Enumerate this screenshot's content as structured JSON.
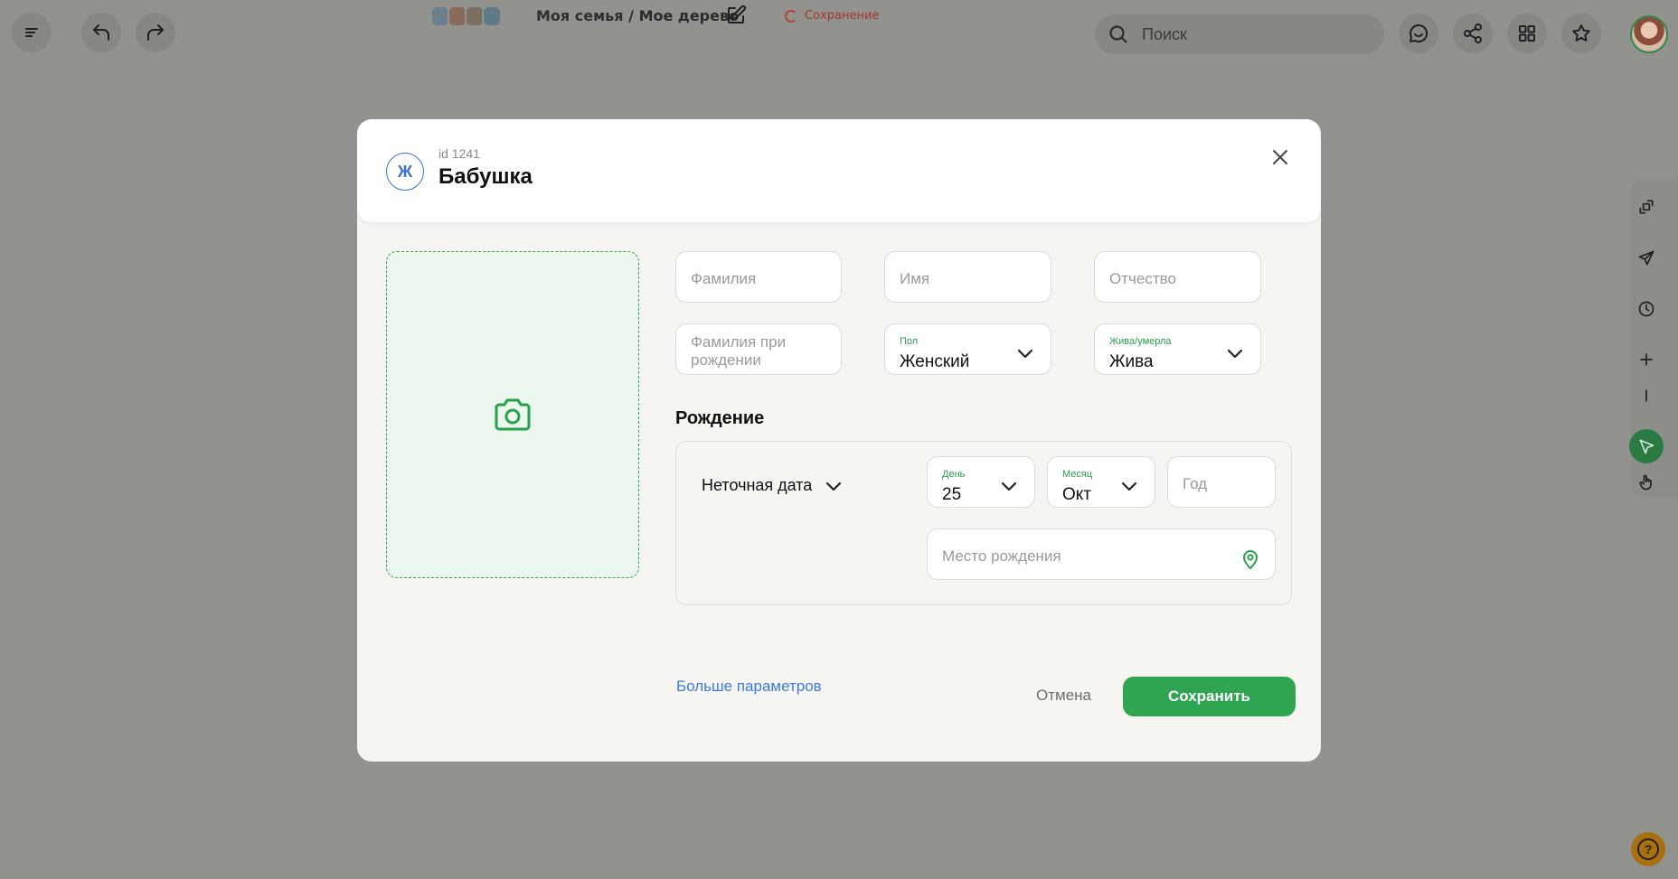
{
  "topbar": {
    "breadcrumb_family": "Моя семья",
    "breadcrumb_separator": "/",
    "breadcrumb_tree": "Мое дерево",
    "saving_status": "Сохранение",
    "search_placeholder": "Поиск"
  },
  "icons": {
    "menu": "menu-icon",
    "undo": "undo-icon",
    "redo": "redo-icon",
    "edit": "pencil-icon",
    "search": "search-icon",
    "chat": "chat-icon",
    "share": "share-icon",
    "grid": "grid-icon",
    "star": "star-icon"
  },
  "modal": {
    "gender_letter": "Ж",
    "person_id": "id 1241",
    "person_name": "Бабушка",
    "fields": {
      "last_name_placeholder": "Фамилия",
      "first_name_placeholder": "Имя",
      "patronymic_placeholder": "Отчество",
      "birth_last_name_placeholder": "Фамилия при рождении",
      "gender_label": "Пол",
      "gender_value": "Женский",
      "alive_label": "Жива/умерла",
      "alive_value": "Жива"
    },
    "birth": {
      "title": "Рождение",
      "date_type": "Неточная дата",
      "day_label": "День",
      "day_value": "25",
      "month_label": "Месяц",
      "month_value": "Окт",
      "year_placeholder": "Год",
      "place_placeholder": "Место рождения"
    },
    "more_params": "Больше параметров",
    "cancel": "Отмена",
    "save": "Сохранить"
  },
  "help": "?",
  "colors": {
    "accent_green": "#2fa552",
    "link_blue": "#3b7be0",
    "saving_red": "#a3362d",
    "overlay": "#92928f"
  }
}
